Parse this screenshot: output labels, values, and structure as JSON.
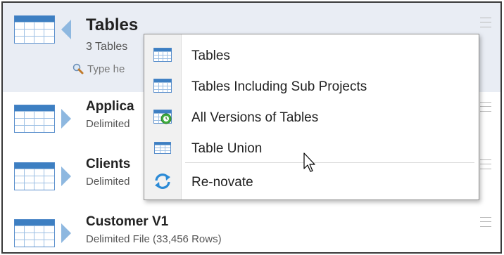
{
  "header": {
    "title": "Tables",
    "subtitle": "3 Tables",
    "search_placeholder": "Type he"
  },
  "rows": [
    {
      "title": "Applica",
      "subtitle": "Delimited"
    },
    {
      "title": "Clients",
      "subtitle": "Delimited"
    },
    {
      "title": "Customer V1",
      "subtitle": "Delimited File  (33,456 Rows)"
    }
  ],
  "menu": {
    "items": [
      {
        "label": "Tables",
        "icon": "table-icon"
      },
      {
        "label": "Tables Including Sub Projects",
        "icon": "table-icon"
      },
      {
        "label": "All Versions of Tables",
        "icon": "table-versions-icon"
      },
      {
        "label": "Table Union",
        "icon": "table-union-icon"
      },
      {
        "label": "Re-novate",
        "icon": "renovate-icon"
      }
    ]
  },
  "colors": {
    "header_bg": "#e9edf4",
    "arrow_blue": "#8eb8e0",
    "table_icon_blue": "#3d7fc2"
  }
}
